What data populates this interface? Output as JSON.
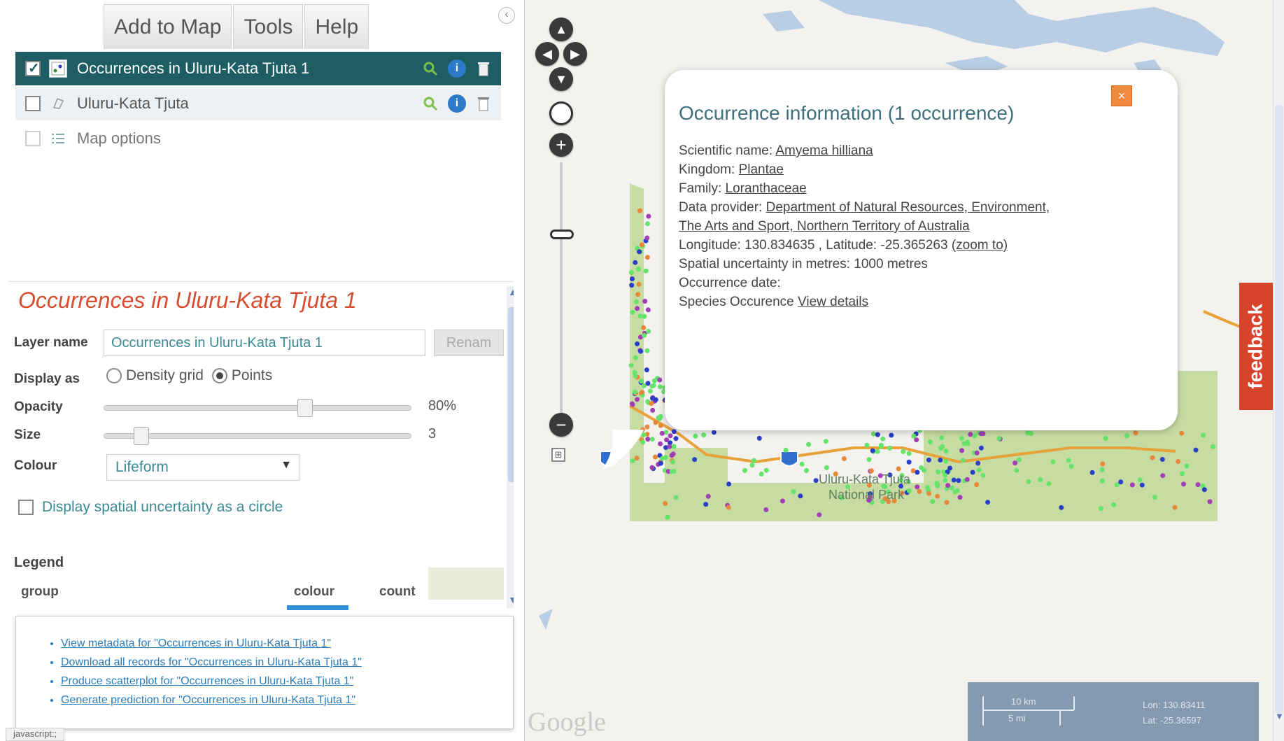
{
  "menu": {
    "tabs": [
      "Add to Map",
      "Tools",
      "Help"
    ],
    "collapse_icon": "chevron-left-icon"
  },
  "layers": [
    {
      "label": "Occurrences in Uluru-Kata Tjuta 1",
      "checked": true,
      "selected": true
    },
    {
      "label": "Uluru-Kata Tjuta",
      "checked": false,
      "selected": false
    },
    {
      "label": "Map options"
    }
  ],
  "layer_props": {
    "title": "Occurrences in Uluru-Kata Tjuta 1",
    "layer_name_label": "Layer name",
    "layer_name_value": "Occurrences in Uluru-Kata Tjuta 1",
    "rename_label": "Renam",
    "display_as_label": "Display as",
    "display_options": [
      "Density grid",
      "Points"
    ],
    "display_selected": "Points",
    "opacity_label": "Opacity",
    "opacity_value": "80%",
    "opacity_level": 0.66,
    "size_label": "Size",
    "size_value": "3",
    "size_level": 0.1,
    "colour_label": "Colour",
    "colour_value": "Lifeform",
    "uncertainty_label": "Display spatial uncertainty as a circle",
    "legend_label": "Legend",
    "legend_headers": {
      "group": "group",
      "colour": "colour",
      "count": "count"
    }
  },
  "links": [
    "View metadata for \"Occurrences in Uluru-Kata Tjuta 1\"",
    "Download all records for \"Occurrences in Uluru-Kata Tjuta 1\"",
    "Produce scatterplot for \"Occurrences in Uluru-Kata Tjuta 1\"",
    "Generate prediction for \"Occurrences in Uluru-Kata Tjuta 1\""
  ],
  "status_text": "javascript:;",
  "popup": {
    "title": "Occurrence information (1 occurrence)",
    "scientific_name_label": "Scientific name:",
    "scientific_name": "Amyema hilliana",
    "kingdom_label": "Kingdom:",
    "kingdom": "Plantae",
    "family_label": "Family:",
    "family": "Loranthaceae",
    "data_provider_label": "Data provider:",
    "data_provider_line1": "Department of Natural Resources, Environment,",
    "data_provider_line2": "The Arts and Sport, Northern Territory of Australia",
    "location_text": "Longitude: 130.834635 , Latitude: -25.365263",
    "zoom_to": "(zoom to)",
    "uncertainty_text": "Spatial uncertainty in metres: 1000 metres",
    "date_text": "Occurrence date:",
    "species_label": "Species Occurence",
    "view_details": "View details",
    "close_icon": "close-icon"
  },
  "feedback_label": "feedback",
  "map": {
    "park_label_line1": "Uluru-Kata Tjuta",
    "park_label_line2": "National Park",
    "google_logo": "Google",
    "scale_km": "10 km",
    "scale_mi": "5 mi",
    "coord_lon": "Lon: 130.83411",
    "coord_lat": "Lat: -25.36597",
    "colors": {
      "park": "#c7dca3",
      "water": "#b9cde4",
      "road": "#e8a23a",
      "green_pt": "#66e36a",
      "blue_pt": "#2a3ec7",
      "purple_pt": "#a23fb5",
      "orange_pt": "#e8893a"
    }
  }
}
